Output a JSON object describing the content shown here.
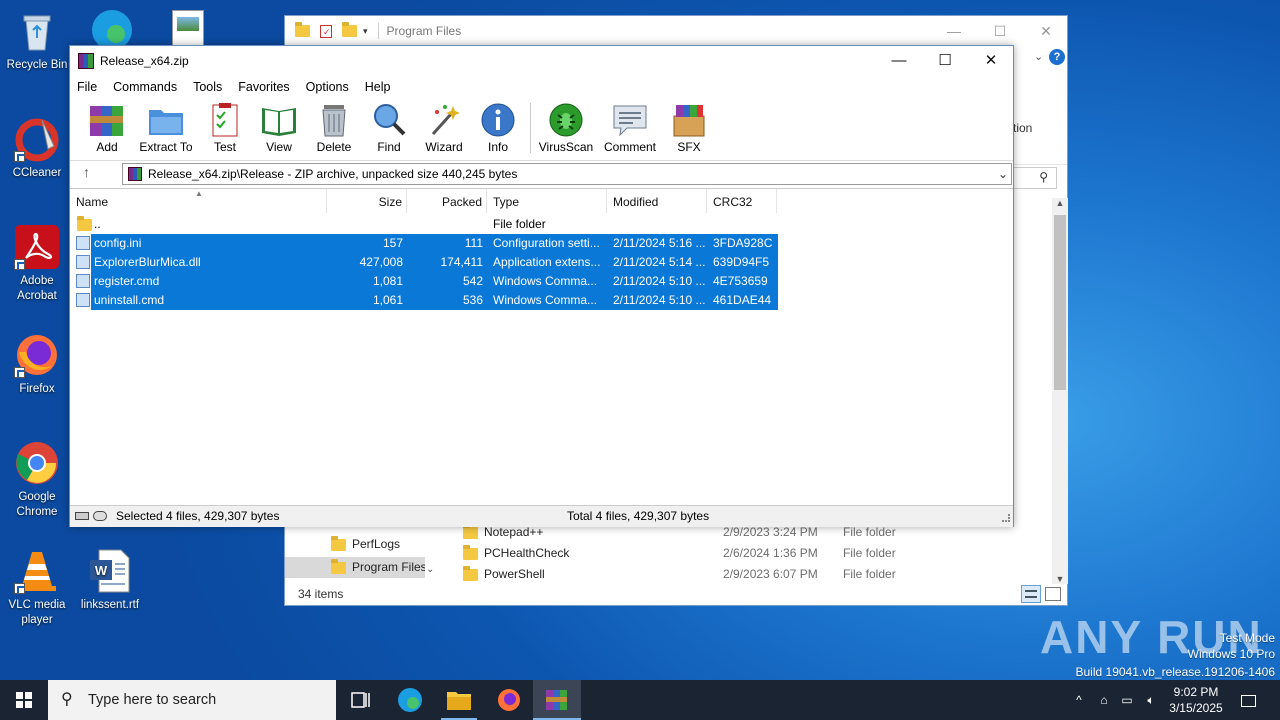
{
  "desktop": {
    "icons": [
      {
        "label": "Recycle Bin"
      },
      {
        "label": "CCleaner"
      },
      {
        "label": "Adobe Acrobat"
      },
      {
        "label": "Firefox"
      },
      {
        "label": "Google Chrome"
      },
      {
        "label": "VLC media player"
      },
      {
        "label": "linkssent.rtf"
      }
    ],
    "watermark": {
      "logo": "ANY RUN",
      "line1": "Test Mode",
      "line2": "Windows 10 Pro",
      "line3": "Build 19041.vb_release.191206-1406"
    }
  },
  "explorer": {
    "title": "Program Files",
    "ribbon_partial": "tion",
    "nav_items": [
      {
        "label": "PerfLogs"
      },
      {
        "label": "Program Files"
      }
    ],
    "rows": [
      {
        "name": "Notepad++",
        "date": "2/9/2023 3:24 PM",
        "type": "File folder"
      },
      {
        "name": "PCHealthCheck",
        "date": "2/6/2024 1:36 PM",
        "type": "File folder"
      },
      {
        "name": "PowerShell",
        "date": "2/9/2023 6:07 PM",
        "type": "File folder"
      }
    ],
    "item_count": "34 items"
  },
  "winrar": {
    "title": "Release_x64.zip",
    "menu": [
      "File",
      "Commands",
      "Tools",
      "Favorites",
      "Options",
      "Help"
    ],
    "toolbar": [
      "Add",
      "Extract To",
      "Test",
      "View",
      "Delete",
      "Find",
      "Wizard",
      "Info",
      "VirusScan",
      "Comment",
      "SFX"
    ],
    "address": "Release_x64.zip\\Release - ZIP archive, unpacked size 440,245 bytes",
    "columns": [
      "Name",
      "Size",
      "Packed",
      "Type",
      "Modified",
      "CRC32"
    ],
    "parent_row": {
      "name": "..",
      "type": "File folder"
    },
    "files": [
      {
        "name": "config.ini",
        "size": "157",
        "packed": "111",
        "type": "Configuration setti...",
        "modified": "2/11/2024 5:16 ...",
        "crc": "3FDA928C"
      },
      {
        "name": "ExplorerBlurMica.dll",
        "size": "427,008",
        "packed": "174,411",
        "type": "Application extens...",
        "modified": "2/11/2024 5:14 ...",
        "crc": "639D94F5"
      },
      {
        "name": "register.cmd",
        "size": "1,081",
        "packed": "542",
        "type": "Windows Comma...",
        "modified": "2/11/2024 5:10 ...",
        "crc": "4E753659"
      },
      {
        "name": "uninstall.cmd",
        "size": "1,061",
        "packed": "536",
        "type": "Windows Comma...",
        "modified": "2/11/2024 5:10 ...",
        "crc": "461DAE44"
      }
    ],
    "status_left": "Selected 4 files, 429,307 bytes",
    "status_right": "Total 4 files, 429,307 bytes"
  },
  "taskbar": {
    "search_placeholder": "Type here to search",
    "time": "9:02 PM",
    "date": "3/15/2025"
  }
}
